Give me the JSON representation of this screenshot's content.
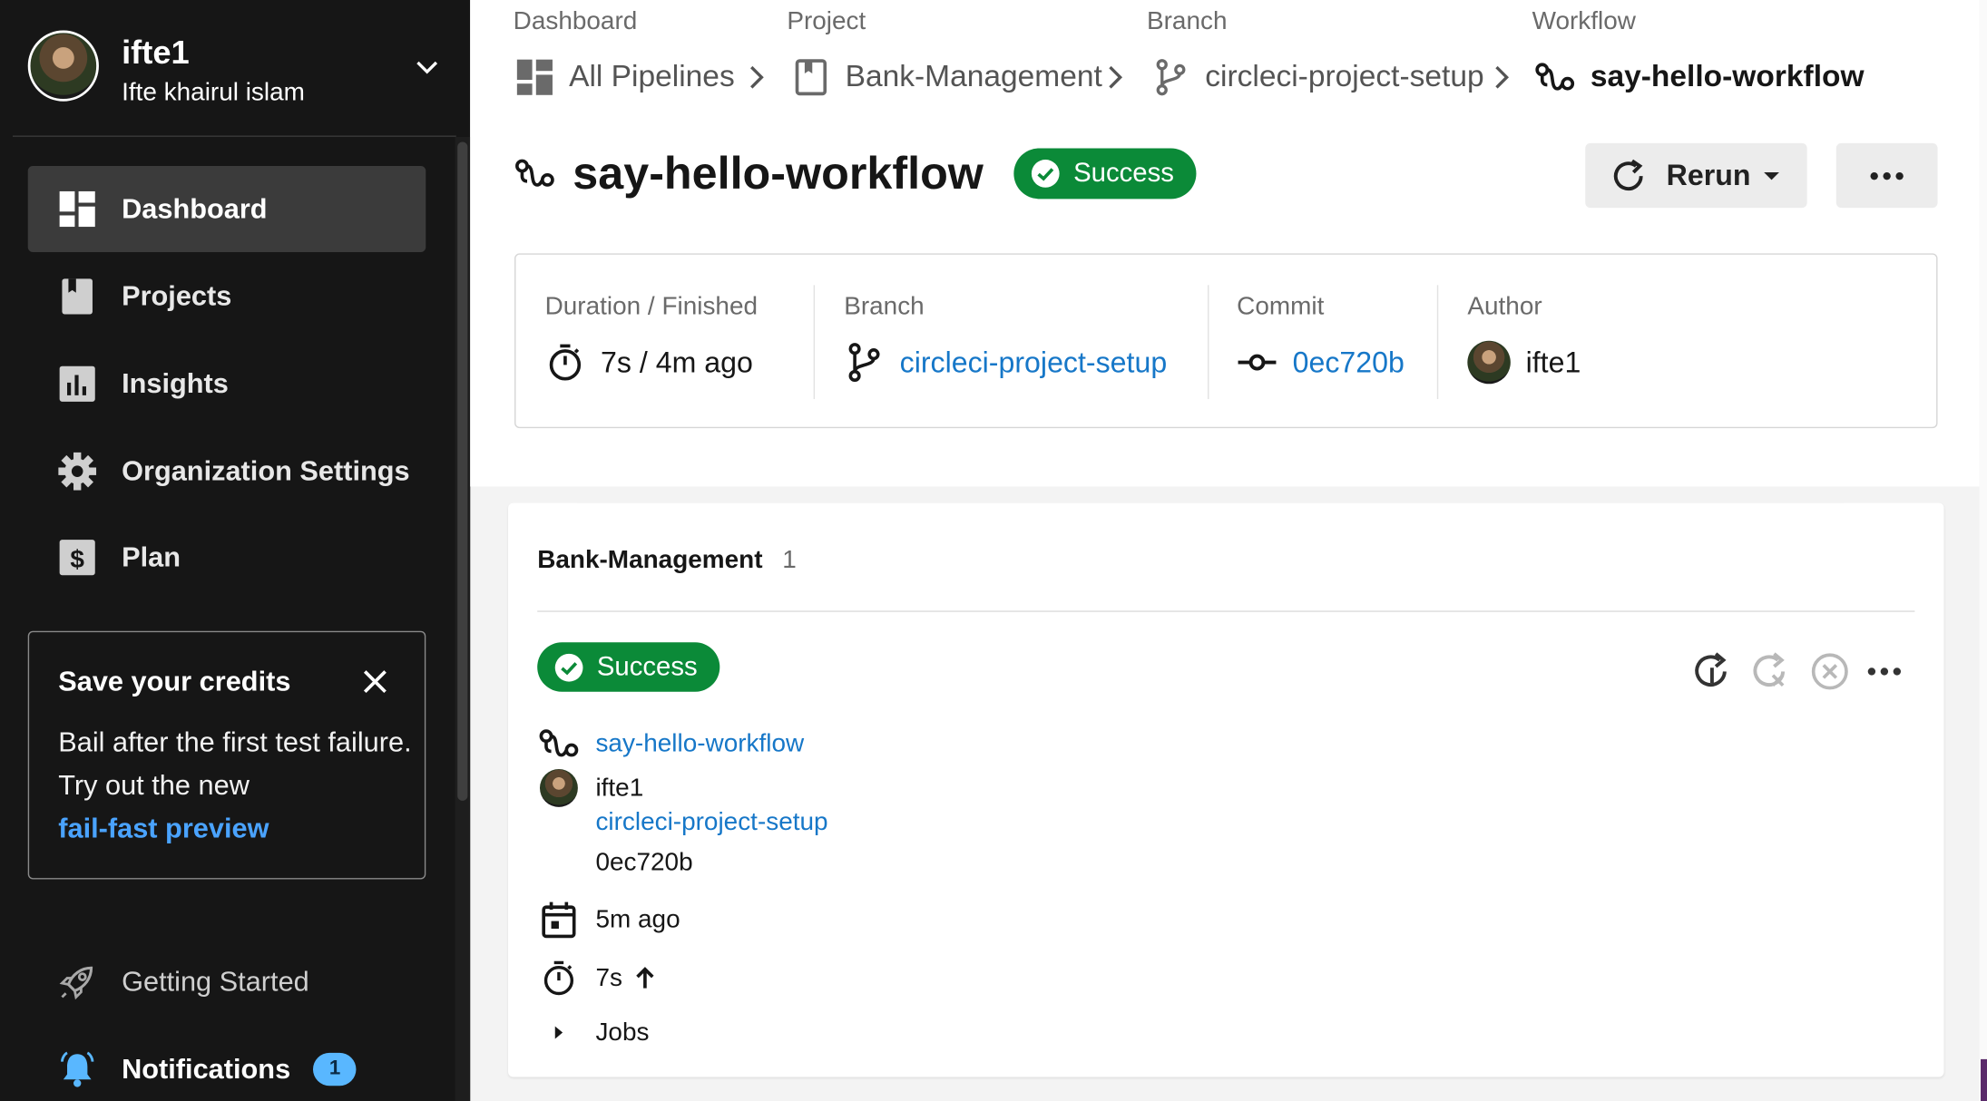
{
  "sidebar": {
    "profile": {
      "username": "ifte1",
      "fullname": "Ifte khairul islam"
    },
    "nav": [
      {
        "label": "Dashboard",
        "icon": "dashboard-icon",
        "active": true
      },
      {
        "label": "Projects",
        "icon": "projects-icon",
        "active": false
      },
      {
        "label": "Insights",
        "icon": "insights-icon",
        "active": false
      },
      {
        "label": "Organization Settings",
        "icon": "gear-icon",
        "active": false
      },
      {
        "label": "Plan",
        "icon": "dollar-icon",
        "active": false
      }
    ],
    "promo": {
      "title": "Save your credits",
      "body": "Bail after the first test failure. Try out the new",
      "link": "fail-fast preview"
    },
    "getting_started": "Getting Started",
    "notifications": {
      "label": "Notifications",
      "count": "1"
    }
  },
  "breadcrumb": {
    "headers": [
      "Dashboard",
      "Project",
      "Branch",
      "Workflow"
    ],
    "items": [
      "All Pipelines",
      "Bank-Management",
      "circleci-project-setup",
      "say-hello-workflow"
    ]
  },
  "workflow": {
    "title": "say-hello-workflow",
    "status": "Success",
    "rerun_label": "Rerun"
  },
  "info": {
    "duration_label": "Duration / Finished",
    "duration_value": "7s / 4m ago",
    "branch_label": "Branch",
    "branch_value": "circleci-project-setup",
    "commit_label": "Commit",
    "commit_value": "0ec720b",
    "author_label": "Author",
    "author_value": "ifte1"
  },
  "pipeline": {
    "project": "Bank-Management",
    "count": "1",
    "status": "Success",
    "workflow": "say-hello-workflow",
    "author": "ifte1",
    "branch": "circleci-project-setup",
    "commit": "0ec720b",
    "time_ago": "5m ago",
    "duration": "7s",
    "jobs_label": "Jobs"
  },
  "colors": {
    "success": "#0b8a38",
    "link": "#1677c8",
    "sidebar_bg": "#161616",
    "promo_link": "#4aa3ff",
    "badge": "#59b7ff"
  }
}
